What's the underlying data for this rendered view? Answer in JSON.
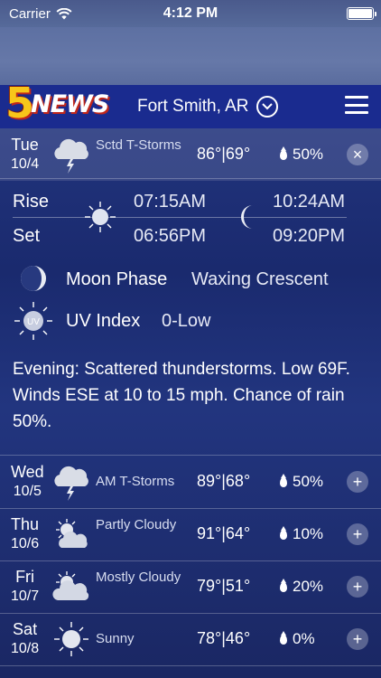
{
  "status": {
    "carrier": "Carrier",
    "time": "4:12 PM"
  },
  "header": {
    "logo_number": "5",
    "logo_word": "NEWS",
    "city": "Fort Smith, AR"
  },
  "selected": {
    "day": "Tue",
    "date": "10/4",
    "condition": "Sctd T-Storms",
    "hi": "86°",
    "lo": "69°",
    "rain": "50%",
    "icon": "thunderstorm-icon"
  },
  "details": {
    "rise_label": "Rise",
    "set_label": "Set",
    "sunrise": "07:15AM",
    "sunset": "06:56PM",
    "moonrise": "10:24AM",
    "moonset": "09:20PM",
    "moon_phase_label": "Moon Phase",
    "moon_phase": "Waxing Crescent",
    "uv_label": "UV Index",
    "uv_value": "0-Low",
    "uv_badge": "UV",
    "description": "Evening: Scattered thunderstorms. Low 69F. Winds ESE at 10 to 15 mph. Chance of rain 50%."
  },
  "forecast": [
    {
      "day": "Wed",
      "date": "10/5",
      "condition": "AM T-Storms",
      "hi": "89°",
      "lo": "68°",
      "rain": "50%",
      "icon": "thunderstorm-icon"
    },
    {
      "day": "Thu",
      "date": "10/6",
      "condition": "Partly Cloudy",
      "hi": "91°",
      "lo": "64°",
      "rain": "10%",
      "icon": "partly-cloudy-icon"
    },
    {
      "day": "Fri",
      "date": "10/7",
      "condition": "Mostly Cloudy",
      "hi": "79°",
      "lo": "51°",
      "rain": "20%",
      "icon": "mostly-cloudy-icon"
    },
    {
      "day": "Sat",
      "date": "10/8",
      "condition": "Sunny",
      "hi": "78°",
      "lo": "46°",
      "rain": "0%",
      "icon": "sunny-icon"
    }
  ],
  "separator": "|",
  "buttons": {
    "close": "×",
    "expand": "+"
  },
  "colors": {
    "header": "#1a2b8f",
    "logo_yellow": "#f7c61a",
    "logo_red": "#c0271b"
  }
}
